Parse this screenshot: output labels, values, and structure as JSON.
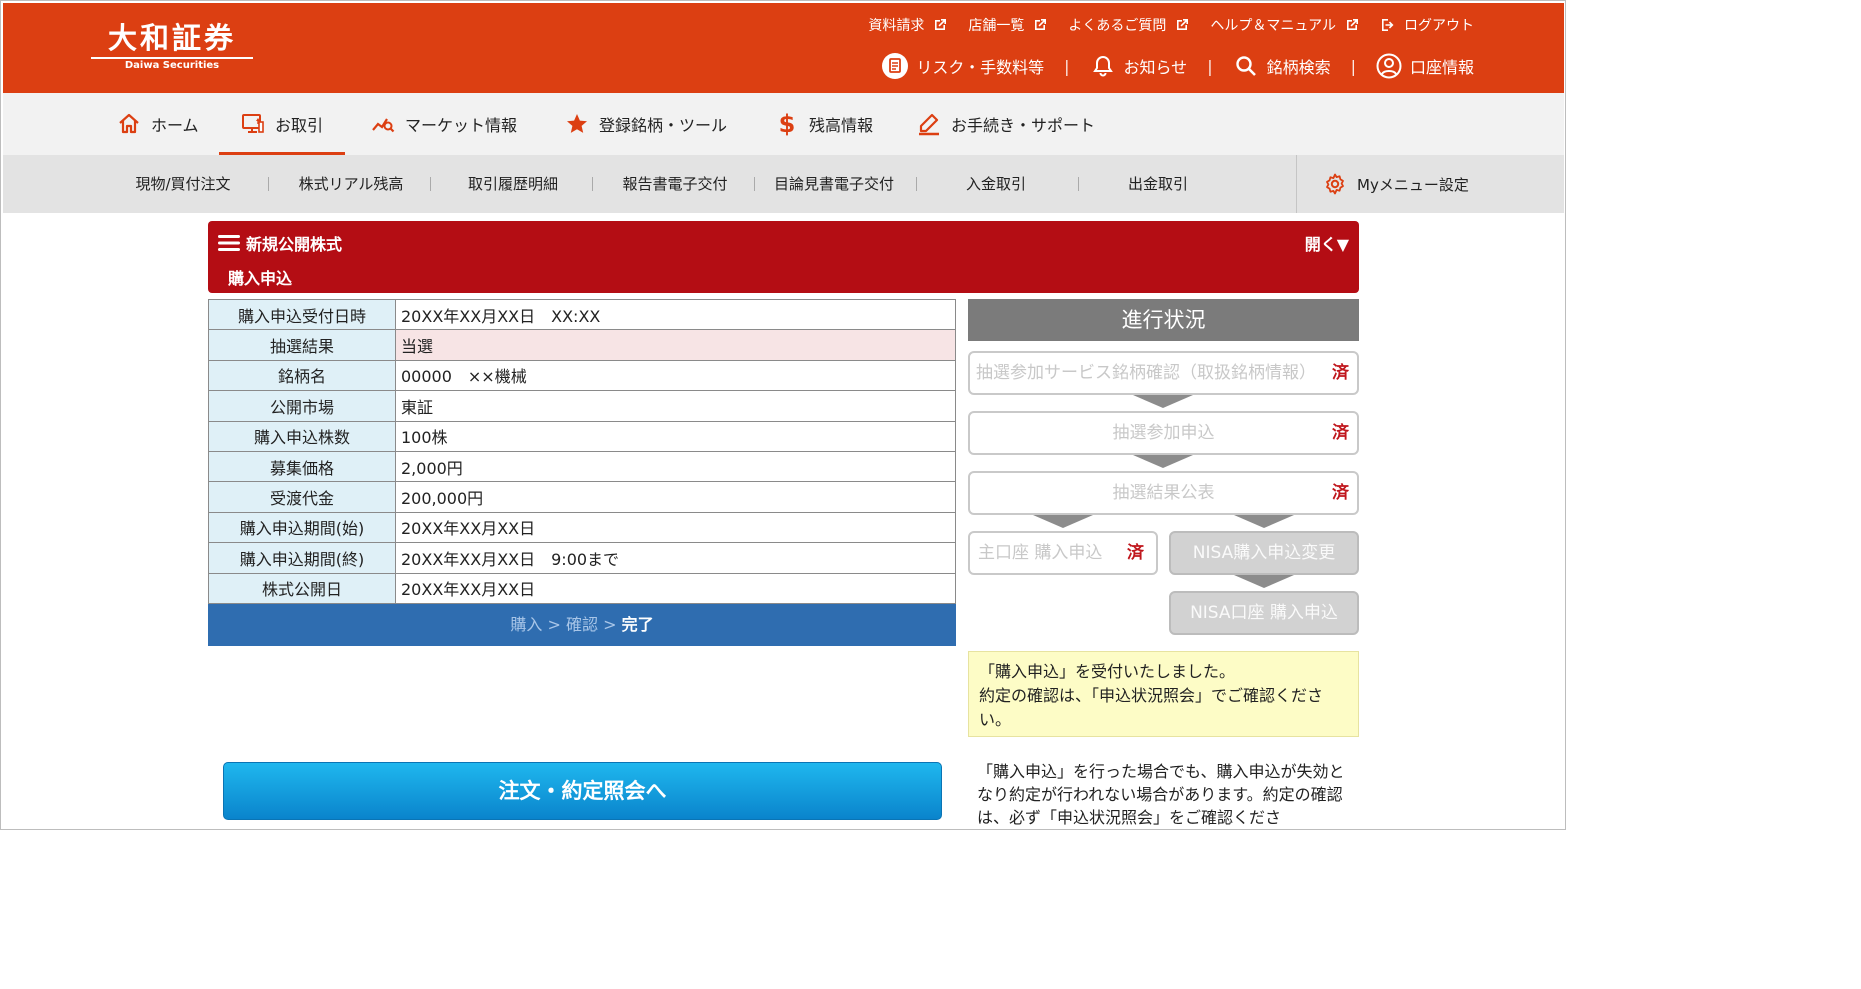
{
  "header": {
    "logo_main": "大和証券",
    "logo_sub": "Daiwa Securities",
    "top_links": [
      "資料請求",
      "店舗一覧",
      "よくあるご質問",
      "ヘルプ＆マニュアル"
    ],
    "logout": "ログアウト",
    "util": {
      "risk": "リスク・手数料等",
      "notice": "お知らせ",
      "search": "銘柄検索",
      "account": "口座情報",
      "separator": "|"
    }
  },
  "main_nav": [
    "ホーム",
    "お取引",
    "マーケット情報",
    "登録銘柄・ツール",
    "残高情報",
    "お手続き・サポート"
  ],
  "sub_nav": {
    "items": [
      "現物/買付注文",
      "株式リアル残高",
      "取引履歴明細",
      "報告書電子交付",
      "目論見書電子交付",
      "入金取引",
      "出金取引"
    ],
    "mymenu": "Myメニュー設定"
  },
  "section": {
    "title": "新規公開株式",
    "subtitle": "購入申込",
    "toggle": "開く▼"
  },
  "details": [
    {
      "label": "購入申込受付日時",
      "value": "20XX年XX月XX日　XX:XX"
    },
    {
      "label": "抽選結果",
      "value": "当選"
    },
    {
      "label": "銘柄名",
      "value": "00000　××機械"
    },
    {
      "label": "公開市場",
      "value": "東証"
    },
    {
      "label": "購入申込株数",
      "value": "100株"
    },
    {
      "label": "募集価格",
      "value": "2,000円"
    },
    {
      "label": "受渡代金",
      "value": "200,000円"
    },
    {
      "label": "購入申込期間(始)",
      "value": "20XX年XX月XX日"
    },
    {
      "label": "購入申込期間(終)",
      "value": "20XX年XX月XX日　9:00まで"
    },
    {
      "label": "株式公開日",
      "value": "20XX年XX月XX日"
    }
  ],
  "steps": {
    "s1": "購入",
    "s2": "確認",
    "s3": "完了",
    "sep": ">"
  },
  "progress": {
    "title": "進行状況",
    "done_mark": "済",
    "step1": "抽選参加サービス銘柄確認（取扱銘柄情報）",
    "step2": "抽選参加申込",
    "step3": "抽選結果公表",
    "step4a": "主口座 購入申込",
    "step4b": "NISA購入申込変更",
    "step5": "NISA口座 購入申込"
  },
  "notice": {
    "line1": "「購入申込」を受付いたしました。",
    "line2": "約定の確認は、「申込状況照会」でご確認ください。"
  },
  "note2": "「購入申込」を行った場合でも、購入申込が失効となり約定が行われない場合があります。約定の確認は、必ず「申込状況照会」をご確認くださ",
  "button": {
    "label": "注文・約定照会へ"
  },
  "colors": {
    "header": "#dc3f12",
    "section": "#b40d14",
    "steps_bar": "#2f6db0",
    "done": "#c0161c"
  }
}
